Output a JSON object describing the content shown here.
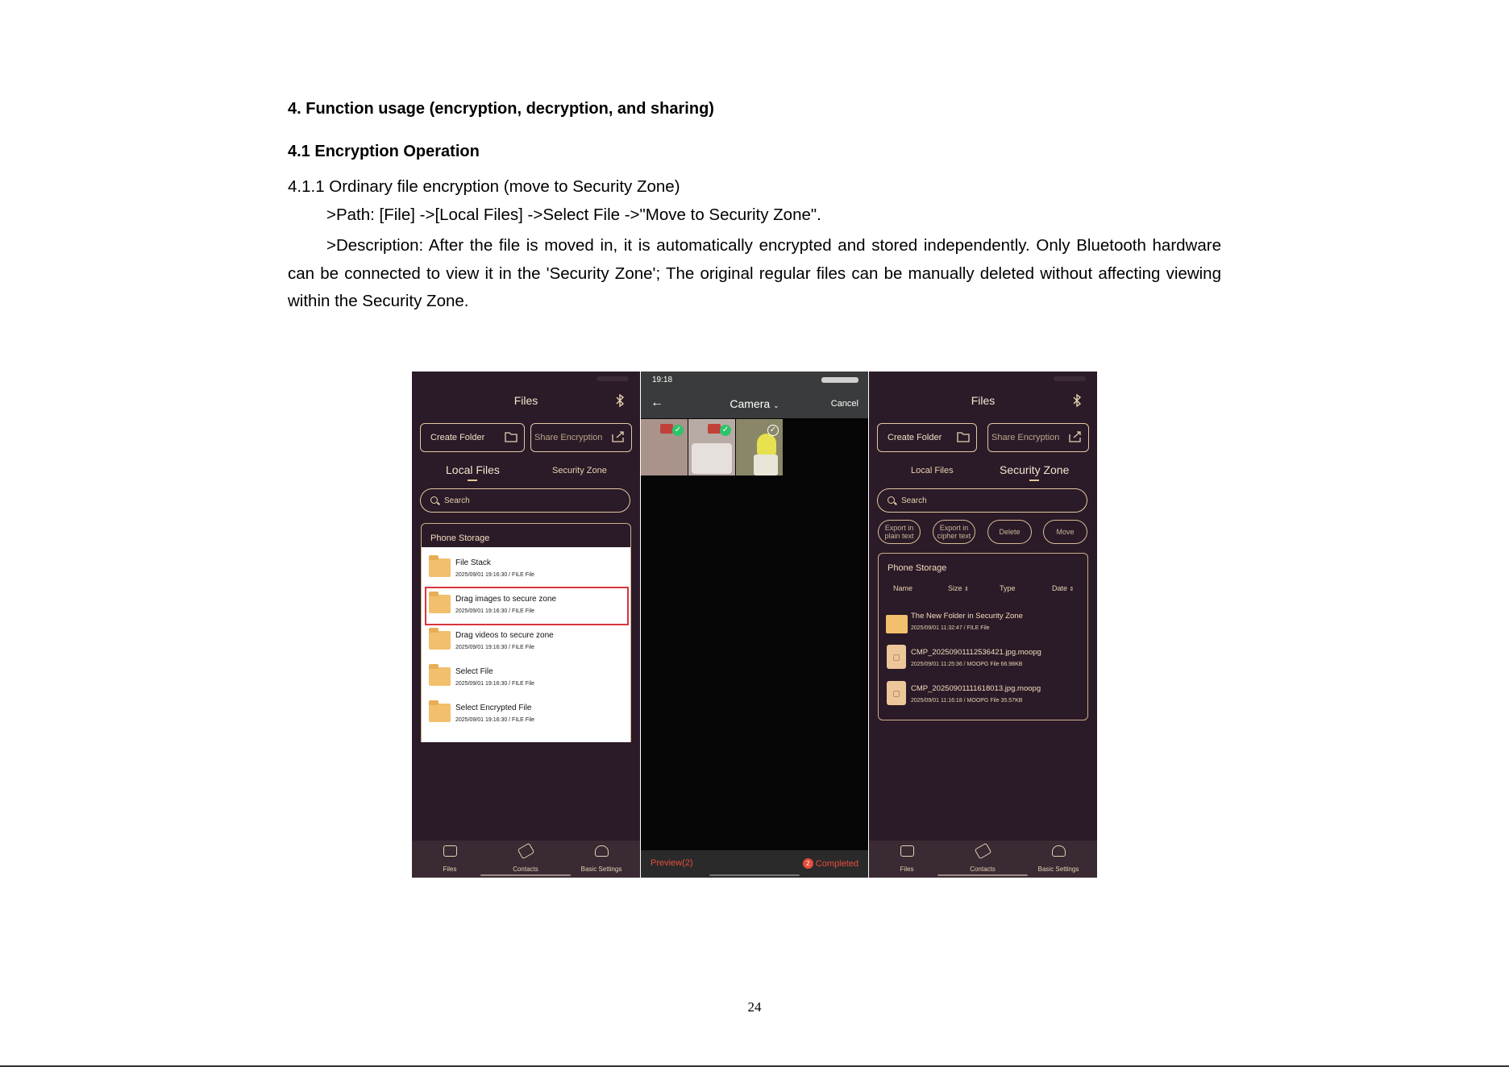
{
  "document": {
    "heading": "4. Function usage (encryption, decryption, and sharing)",
    "subheading": "4.1 Encryption Operation",
    "subsubheading": "4.1.1 Ordinary file encryption (move to Security Zone)",
    "path_text": ">Path: [File] ->[Local Files] ->Select File ->\"Move to Security Zone\".",
    "description_text": ">Description: After the file is moved in, it is automatically encrypted and stored independently. Only Bluetooth hardware can be connected to view it in the 'Security Zone'; The original regular files can be manually deleted without affecting viewing within the Security Zone.",
    "page_number": "24"
  },
  "colors": {
    "app_background": "#2b1a27",
    "accent_border": "#e2c9a3",
    "folder": "#f2bf6c",
    "highlight_border": "#d9343d",
    "completed_red": "#e74c3c"
  },
  "left_screen": {
    "title": "Files",
    "bluetooth_icon": "bluetooth-icon",
    "create_folder": "Create Folder",
    "share_encryption": "Share Encryption",
    "tab_local": "Local Files",
    "tab_security": "Security Zone",
    "active_tab": "Local Files",
    "search_placeholder": "Search",
    "storage_title": "Phone Storage",
    "files": [
      {
        "name": "File Stack",
        "meta": "2025/09/01 19:16:30  /  FILE File"
      },
      {
        "name": "Drag images to secure zone",
        "meta": "2025/09/01 19:16:30  /  FILE File"
      },
      {
        "name": "Drag videos to secure zone",
        "meta": "2025/09/01 19:16:30  /  FILE File"
      },
      {
        "name": "Select File",
        "meta": "2025/09/01 19:16:30  /  FILE File"
      },
      {
        "name": "Select Encrypted File",
        "meta": "2025/09/01 19:16:30  /  FILE File"
      }
    ],
    "highlighted_file": "Drag images to secure zone",
    "nav": {
      "files": "Files",
      "contacts": "Contacts",
      "settings": "Basic Settings"
    }
  },
  "middle_screen": {
    "time": "19:18",
    "title": "Camera",
    "cancel": "Cancel",
    "preview": "Preview(2)",
    "completed_count": "2",
    "completed": "Completed"
  },
  "right_screen": {
    "title": "Files",
    "create_folder": "Create Folder",
    "share_encryption": "Share Encryption",
    "tab_local": "Local Files",
    "tab_security": "Security Zone",
    "active_tab": "Security Zone",
    "search_placeholder": "Search",
    "actions": {
      "export_plain": "Export in plain text",
      "export_cipher": "Export in cipher text",
      "delete": "Delete",
      "move": "Move"
    },
    "storage_title": "Phone Storage",
    "columns": {
      "name": "Name",
      "size": "Size",
      "type": "Type",
      "date": "Date"
    },
    "files": [
      {
        "name": "The New Folder in Security Zone",
        "meta": "2025/09/01 11:32:47  /  FILE File",
        "kind": "folder"
      },
      {
        "name": "CMP_20250901112536421.jpg.moopg",
        "meta": "2025/09/01 11:25:36  /  MOOPG File 66.98KB",
        "kind": "file"
      },
      {
        "name": "CMP_20250901111618013.jpg.moopg",
        "meta": "2025/09/01 11:16:18  /  MOOPG File 35.57KB",
        "kind": "file"
      }
    ],
    "nav": {
      "files": "Files",
      "contacts": "Contacts",
      "settings": "Basic Settings"
    }
  }
}
